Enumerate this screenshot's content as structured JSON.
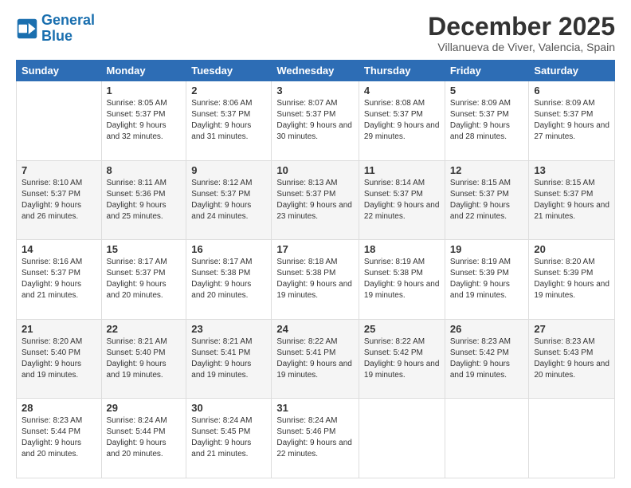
{
  "logo": {
    "line1": "General",
    "line2": "Blue"
  },
  "title": "December 2025",
  "subtitle": "Villanueva de Viver, Valencia, Spain",
  "days_of_week": [
    "Sunday",
    "Monday",
    "Tuesday",
    "Wednesday",
    "Thursday",
    "Friday",
    "Saturday"
  ],
  "weeks": [
    [
      {
        "day": "",
        "sunrise": "",
        "sunset": "",
        "daylight": ""
      },
      {
        "day": "1",
        "sunrise": "Sunrise: 8:05 AM",
        "sunset": "Sunset: 5:37 PM",
        "daylight": "Daylight: 9 hours and 32 minutes."
      },
      {
        "day": "2",
        "sunrise": "Sunrise: 8:06 AM",
        "sunset": "Sunset: 5:37 PM",
        "daylight": "Daylight: 9 hours and 31 minutes."
      },
      {
        "day": "3",
        "sunrise": "Sunrise: 8:07 AM",
        "sunset": "Sunset: 5:37 PM",
        "daylight": "Daylight: 9 hours and 30 minutes."
      },
      {
        "day": "4",
        "sunrise": "Sunrise: 8:08 AM",
        "sunset": "Sunset: 5:37 PM",
        "daylight": "Daylight: 9 hours and 29 minutes."
      },
      {
        "day": "5",
        "sunrise": "Sunrise: 8:09 AM",
        "sunset": "Sunset: 5:37 PM",
        "daylight": "Daylight: 9 hours and 28 minutes."
      },
      {
        "day": "6",
        "sunrise": "Sunrise: 8:09 AM",
        "sunset": "Sunset: 5:37 PM",
        "daylight": "Daylight: 9 hours and 27 minutes."
      }
    ],
    [
      {
        "day": "7",
        "sunrise": "",
        "sunset": "",
        "daylight": ""
      },
      {
        "day": "8",
        "sunrise": "Sunrise: 8:11 AM",
        "sunset": "Sunset: 5:36 PM",
        "daylight": "Daylight: 9 hours and 25 minutes."
      },
      {
        "day": "9",
        "sunrise": "Sunrise: 8:12 AM",
        "sunset": "Sunset: 5:37 PM",
        "daylight": "Daylight: 9 hours and 24 minutes."
      },
      {
        "day": "10",
        "sunrise": "Sunrise: 8:13 AM",
        "sunset": "Sunset: 5:37 PM",
        "daylight": "Daylight: 9 hours and 23 minutes."
      },
      {
        "day": "11",
        "sunrise": "Sunrise: 8:14 AM",
        "sunset": "Sunset: 5:37 PM",
        "daylight": "Daylight: 9 hours and 22 minutes."
      },
      {
        "day": "12",
        "sunrise": "Sunrise: 8:15 AM",
        "sunset": "Sunset: 5:37 PM",
        "daylight": "Daylight: 9 hours and 22 minutes."
      },
      {
        "day": "13",
        "sunrise": "Sunrise: 8:15 AM",
        "sunset": "Sunset: 5:37 PM",
        "daylight": "Daylight: 9 hours and 21 minutes."
      }
    ],
    [
      {
        "day": "14",
        "sunrise": "",
        "sunset": "",
        "daylight": ""
      },
      {
        "day": "15",
        "sunrise": "Sunrise: 8:17 AM",
        "sunset": "Sunset: 5:37 PM",
        "daylight": "Daylight: 9 hours and 20 minutes."
      },
      {
        "day": "16",
        "sunrise": "Sunrise: 8:17 AM",
        "sunset": "Sunset: 5:38 PM",
        "daylight": "Daylight: 9 hours and 20 minutes."
      },
      {
        "day": "17",
        "sunrise": "Sunrise: 8:18 AM",
        "sunset": "Sunset: 5:38 PM",
        "daylight": "Daylight: 9 hours and 19 minutes."
      },
      {
        "day": "18",
        "sunrise": "Sunrise: 8:19 AM",
        "sunset": "Sunset: 5:38 PM",
        "daylight": "Daylight: 9 hours and 19 minutes."
      },
      {
        "day": "19",
        "sunrise": "Sunrise: 8:19 AM",
        "sunset": "Sunset: 5:39 PM",
        "daylight": "Daylight: 9 hours and 19 minutes."
      },
      {
        "day": "20",
        "sunrise": "Sunrise: 8:20 AM",
        "sunset": "Sunset: 5:39 PM",
        "daylight": "Daylight: 9 hours and 19 minutes."
      }
    ],
    [
      {
        "day": "21",
        "sunrise": "Sunrise: 8:20 AM",
        "sunset": "Sunset: 5:40 PM",
        "daylight": "Daylight: 9 hours and 19 minutes."
      },
      {
        "day": "22",
        "sunrise": "Sunrise: 8:21 AM",
        "sunset": "Sunset: 5:40 PM",
        "daylight": "Daylight: 9 hours and 19 minutes."
      },
      {
        "day": "23",
        "sunrise": "Sunrise: 8:21 AM",
        "sunset": "Sunset: 5:41 PM",
        "daylight": "Daylight: 9 hours and 19 minutes."
      },
      {
        "day": "24",
        "sunrise": "Sunrise: 8:22 AM",
        "sunset": "Sunset: 5:41 PM",
        "daylight": "Daylight: 9 hours and 19 minutes."
      },
      {
        "day": "25",
        "sunrise": "Sunrise: 8:22 AM",
        "sunset": "Sunset: 5:42 PM",
        "daylight": "Daylight: 9 hours and 19 minutes."
      },
      {
        "day": "26",
        "sunrise": "Sunrise: 8:23 AM",
        "sunset": "Sunset: 5:42 PM",
        "daylight": "Daylight: 9 hours and 19 minutes."
      },
      {
        "day": "27",
        "sunrise": "Sunrise: 8:23 AM",
        "sunset": "Sunset: 5:43 PM",
        "daylight": "Daylight: 9 hours and 20 minutes."
      }
    ],
    [
      {
        "day": "28",
        "sunrise": "Sunrise: 8:23 AM",
        "sunset": "Sunset: 5:44 PM",
        "daylight": "Daylight: 9 hours and 20 minutes."
      },
      {
        "day": "29",
        "sunrise": "Sunrise: 8:24 AM",
        "sunset": "Sunset: 5:44 PM",
        "daylight": "Daylight: 9 hours and 20 minutes."
      },
      {
        "day": "30",
        "sunrise": "Sunrise: 8:24 AM",
        "sunset": "Sunset: 5:45 PM",
        "daylight": "Daylight: 9 hours and 21 minutes."
      },
      {
        "day": "31",
        "sunrise": "Sunrise: 8:24 AM",
        "sunset": "Sunset: 5:46 PM",
        "daylight": "Daylight: 9 hours and 22 minutes."
      },
      {
        "day": "",
        "sunrise": "",
        "sunset": "",
        "daylight": ""
      },
      {
        "day": "",
        "sunrise": "",
        "sunset": "",
        "daylight": ""
      },
      {
        "day": "",
        "sunrise": "",
        "sunset": "",
        "daylight": ""
      }
    ]
  ],
  "week7_sunday": {
    "sunrise": "Sunrise: 8:10 AM",
    "sunset": "Sunset: 5:37 PM",
    "daylight": "Daylight: 9 hours and 26 minutes."
  },
  "week14_sunday": {
    "sunrise": "Sunrise: 8:16 AM",
    "sunset": "Sunset: 5:37 PM",
    "daylight": "Daylight: 9 hours and 21 minutes."
  }
}
